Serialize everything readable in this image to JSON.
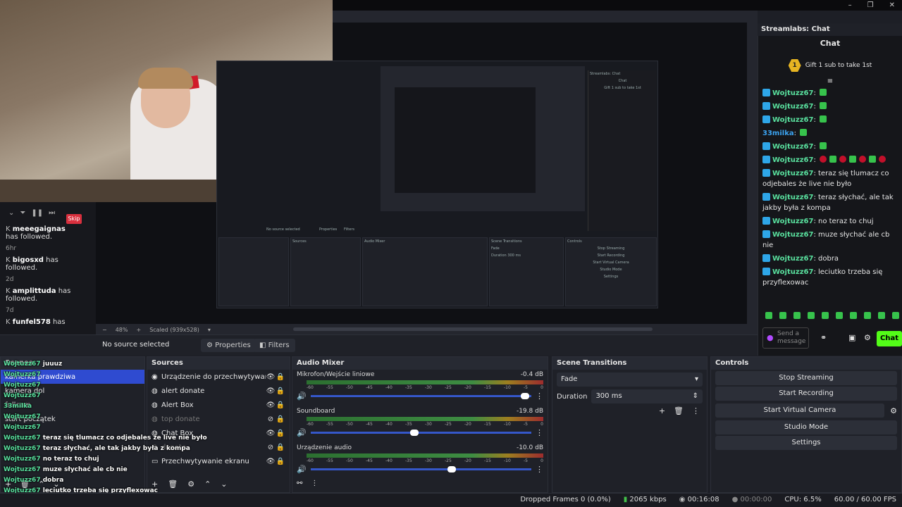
{
  "window": {
    "controls": [
      "–",
      "❐",
      "✕"
    ]
  },
  "preview": {
    "zoom": "48%",
    "scaled": "Scaled (939x528)",
    "nested_labels": [
      "Streamlabs: Chat",
      "Chat",
      "Gift 1 sub to take 1st",
      "No source selected",
      "Properties",
      "Filters",
      "Sources",
      "Audio Mixer",
      "Scene Transitions",
      "Controls",
      "Stop Streaming",
      "Start Recording",
      "Start Virtual Camera",
      "Studio Mode",
      "Settings",
      "Fade",
      "Duration",
      "300 ms"
    ]
  },
  "activity": {
    "skip_label": "Skip",
    "items": [
      {
        "name": "meeegaignas",
        "action": "has followed.",
        "time": "6hr"
      },
      {
        "name": "bigosxd",
        "action": "has followed.",
        "time": "2d"
      },
      {
        "name": "amplittuda",
        "action": "has followed.",
        "time": "7d"
      },
      {
        "name": "funfel578",
        "action": "has",
        "time": ""
      }
    ]
  },
  "source_bar": {
    "status": "No source selected",
    "properties": "Properties",
    "filters": "Filters"
  },
  "chat": {
    "dock_title": "Streamlabs: Chat",
    "header": "Chat",
    "gift_text": "Gift 1 sub to take 1st",
    "gift_count": "1",
    "messages": [
      {
        "user": "Wojtuzz67",
        "text": ""
      },
      {
        "user": "Wojtuzz67",
        "text": ""
      },
      {
        "user": "Wojtuzz67",
        "text": ""
      },
      {
        "user": "33milka",
        "text": ""
      },
      {
        "user": "Wojtuzz67",
        "text": ""
      },
      {
        "user": "Wojtuzz67",
        "text": ""
      },
      {
        "user": "Wojtuzz67",
        "text": "teraz się tlumacz co odjebales że live nie było"
      },
      {
        "user": "Wojtuzz67",
        "text": "teraz słychać, ale tak jakby była z kompa"
      },
      {
        "user": "Wojtuzz67",
        "text": "no teraz to chuj"
      },
      {
        "user": "Wojtuzz67",
        "text": "muze słychać ale cb nie"
      },
      {
        "user": "Wojtuzz67",
        "text": "dobra"
      },
      {
        "user": "Wojtuzz67",
        "text": "leciutko trzeba się przyflexowac"
      }
    ],
    "input_placeholder": "Send a message",
    "send_label": "Chat"
  },
  "scenes": {
    "title": "Scenes",
    "items": [
      "kamerka prawdziwa",
      "kamera dol",
      "fullcam",
      "start początek"
    ],
    "selected_index": 0
  },
  "sources": {
    "title": "Sources",
    "items": [
      {
        "label": "Urządzenie do przechwytywania wideo",
        "icon": "camera-icon",
        "visible": true
      },
      {
        "label": "alert donate",
        "icon": "browser-icon",
        "visible": true
      },
      {
        "label": "Alert Box",
        "icon": "browser-icon",
        "visible": true
      },
      {
        "label": "top donate",
        "icon": "browser-icon",
        "visible": false
      },
      {
        "label": "Chat Box",
        "icon": "browser-icon",
        "visible": true
      },
      {
        "label": "donate",
        "icon": "browser-icon",
        "visible": false
      },
      {
        "label": "Przechwytywanie ekranu",
        "icon": "monitor-icon",
        "visible": true
      }
    ]
  },
  "mixer": {
    "title": "Audio Mixer",
    "ticks": [
      "-60",
      "-55",
      "-50",
      "-45",
      "-40",
      "-35",
      "-30",
      "-25",
      "-20",
      "-15",
      "-10",
      "-5",
      "0"
    ],
    "channels": [
      {
        "name": "Mikrofon/Wejście liniowe",
        "db": "-0.4 dB",
        "volume": 0.99
      },
      {
        "name": "Soundboard",
        "db": "-19.8 dB",
        "volume": 0.49
      },
      {
        "name": "Urządzenie audio",
        "db": "-10.0 dB",
        "volume": 0.66
      }
    ]
  },
  "transitions": {
    "title": "Scene Transitions",
    "type": "Fade",
    "duration_label": "Duration",
    "duration_value": "300 ms"
  },
  "controls": {
    "title": "Controls",
    "buttons": [
      "Stop Streaming",
      "Start Recording",
      "Start Virtual Camera",
      "Studio Mode",
      "Settings"
    ]
  },
  "overlay_chat": [
    {
      "user": "Wojtuzz67",
      "text": "juuuz"
    },
    {
      "user": "Wojtuzz67",
      "text": ""
    },
    {
      "user": "Wojtuzz67",
      "text": ""
    },
    {
      "user": "Wojtuzz67",
      "text": ""
    },
    {
      "user": "33milka",
      "text": ""
    },
    {
      "user": "Wojtuzz67",
      "text": ""
    },
    {
      "user": "Wojtuzz67",
      "text": ""
    },
    {
      "user": "Wojtuzz67",
      "text": "teraz się tlumacz co odjebales że live nie było"
    },
    {
      "user": "Wojtuzz67",
      "text": "teraz słychać, ale tak jakby była z kompa"
    },
    {
      "user": "Wojtuzz67",
      "text": "no teraz to chuj"
    },
    {
      "user": "Wojtuzz67",
      "text": "muze słychać ale cb nie"
    },
    {
      "user": "Wojtuzz67",
      "text": "dobra"
    },
    {
      "user": "Wojtuzz67",
      "text": "leciutko trzeba się przyflexowac"
    }
  ],
  "status": {
    "dropped": "Dropped Frames 0 (0.0%)",
    "bitrate": "2065 kbps",
    "stream_time": "00:16:08",
    "rec_time": "00:00:00",
    "cpu": "CPU: 6.5%",
    "fps": "60.00 / 60.00 FPS"
  }
}
